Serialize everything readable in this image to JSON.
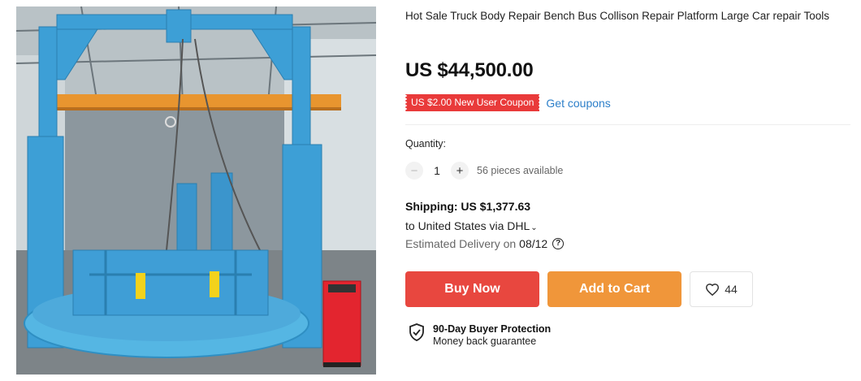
{
  "product": {
    "image_alt": "Blue truck body repair bench platform with crane frame in factory",
    "title": "Hot Sale Truck Body Repair Bench Bus Collison Repair Platform Large Car repair Tools",
    "price": "US $44,500.00",
    "coupon_label": "US $2.00 New User Coupon",
    "get_coupons_label": "Get coupons"
  },
  "quantity": {
    "label": "Quantity:",
    "minus": "−",
    "value": "1",
    "plus": "+",
    "available": "56 pieces available"
  },
  "shipping": {
    "label": "Shipping: US $1,377.63",
    "destination": "to United States via DHL",
    "delivery_label": "Estimated Delivery on",
    "delivery_date": "08/12",
    "help_icon": "?"
  },
  "actions": {
    "buy_now": "Buy Now",
    "add_to_cart": "Add to Cart",
    "wishlist_count": "44"
  },
  "protection": {
    "title": "90-Day Buyer Protection",
    "subtitle": "Money back guarantee"
  },
  "colors": {
    "buy_now": "#e8473f",
    "add_to_cart": "#f0963a",
    "coupon": "#e93a3a",
    "link": "#2d7fc9"
  }
}
